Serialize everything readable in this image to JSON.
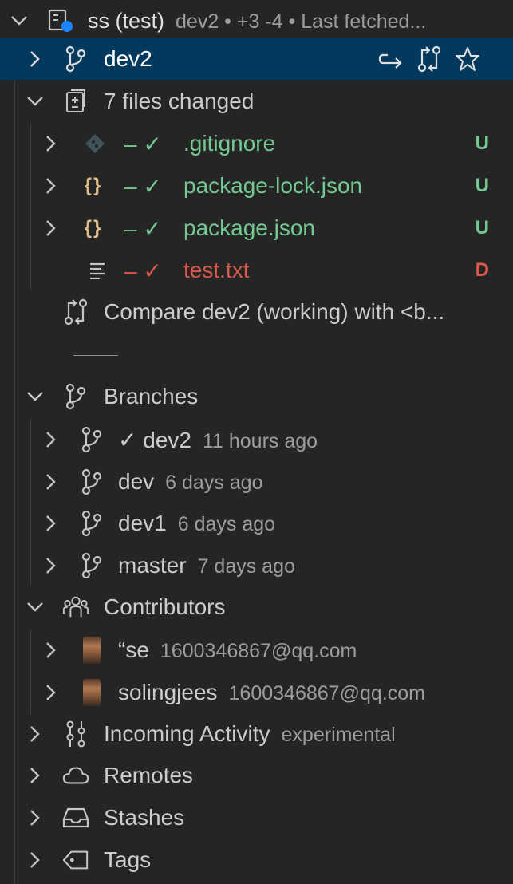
{
  "repo": {
    "name": "ss (test)",
    "description": "dev2 • +3 -4 • Last fetched..."
  },
  "current_branch": {
    "name": "dev2"
  },
  "changes": {
    "label": "7 files changed",
    "files": [
      {
        "name": ".gitignore",
        "markers": "– ✓",
        "status": "U",
        "color": "#73c991"
      },
      {
        "name": "package-lock.json",
        "markers": "– ✓",
        "status": "U",
        "color": "#73c991"
      },
      {
        "name": "package.json",
        "markers": "– ✓",
        "status": "U",
        "color": "#73c991"
      },
      {
        "name": "test.txt",
        "markers": "– ✓",
        "status": "D",
        "color": "#d9584a"
      }
    ],
    "compare_label": "Compare dev2 (working) with <b..."
  },
  "branches": {
    "label": "Branches",
    "items": [
      {
        "name": "✓ dev2",
        "age": "11 hours ago"
      },
      {
        "name": "dev",
        "age": "6 days ago"
      },
      {
        "name": "dev1",
        "age": "6 days ago"
      },
      {
        "name": "master",
        "age": "7 days ago"
      }
    ]
  },
  "contributors": {
    "label": "Contributors",
    "items": [
      {
        "name": "“se",
        "email": "1600346867@qq.com"
      },
      {
        "name": "solingjees",
        "email": "1600346867@qq.com"
      }
    ]
  },
  "incoming": {
    "label": "Incoming Activity",
    "tag": "experimental"
  },
  "remotes": {
    "label": "Remotes"
  },
  "stashes": {
    "label": "Stashes"
  },
  "tags": {
    "label": "Tags"
  },
  "colors": {
    "background": "#252526",
    "selection": "#04395e",
    "added": "#73c991",
    "deleted": "#d9584a",
    "json": "#e2c08d"
  }
}
